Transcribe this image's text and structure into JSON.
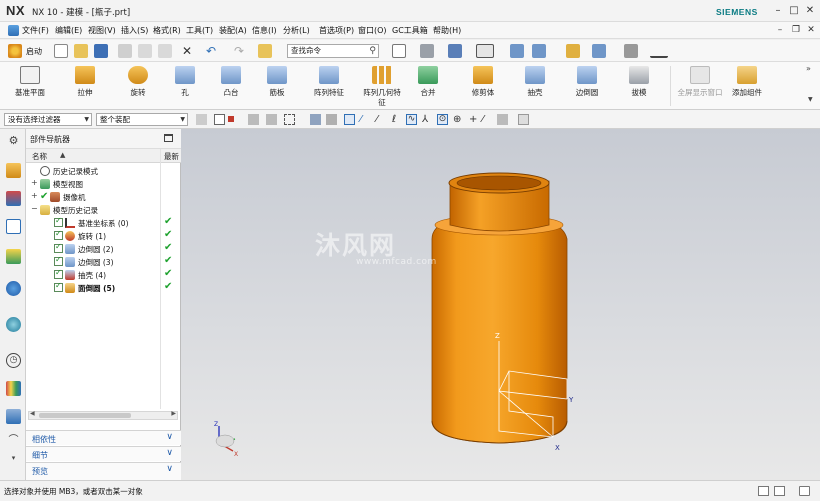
{
  "titlebar": {
    "logo": "NX",
    "title": "NX 10 - 建模 - [瓶子.prt]",
    "brand": "SIEMENS",
    "buttons": [
      "minimize",
      "maximize",
      "close"
    ]
  },
  "menubar": {
    "items": [
      "文件(F)",
      "编辑(E)",
      "视图(V)",
      "插入(S)",
      "格式(R)",
      "工具(T)",
      "装配(A)",
      "信息(I)",
      "分析(L)",
      "首选项(P)",
      "窗口(O)",
      "GC工具箱",
      "帮助(H)"
    ]
  },
  "qat": {
    "start_label": "启动",
    "find_placeholder": "查找命令"
  },
  "ribbon": {
    "buttons": [
      "基准平面",
      "拉伸",
      "旋转",
      "孔",
      "凸台",
      "筋板",
      "阵列特征",
      "阵列几何特征",
      "合并",
      "修剪体",
      "抽壳",
      "边倒圆",
      "拔模",
      "全屏显示窗口",
      "添加组件"
    ]
  },
  "selection_bar": {
    "filter": "没有选择过滤器",
    "scope": "整个装配"
  },
  "navigator": {
    "title": "部件导航器",
    "col_name": "名称",
    "col_latest": "最新",
    "items": [
      {
        "label": "历史记录模式",
        "level": 0,
        "expander": "",
        "latest": false
      },
      {
        "label": "模型视图",
        "level": 0,
        "expander": "+",
        "latest": false
      },
      {
        "label": "摄像机",
        "level": 0,
        "expander": "+",
        "latest": false
      },
      {
        "label": "模型历史记录",
        "level": 0,
        "expander": "−",
        "latest": false
      },
      {
        "label": "基准坐标系 (0)",
        "level": 1,
        "expander": "",
        "latest": true
      },
      {
        "label": "旋转 (1)",
        "level": 1,
        "expander": "",
        "latest": true
      },
      {
        "label": "边倒圆 (2)",
        "level": 1,
        "expander": "",
        "latest": true
      },
      {
        "label": "边倒圆 (3)",
        "level": 1,
        "expander": "",
        "latest": true
      },
      {
        "label": "抽壳 (4)",
        "level": 1,
        "expander": "",
        "latest": true
      },
      {
        "label": "面倒圆 (5)",
        "level": 1,
        "expander": "",
        "latest": true
      }
    ],
    "panels": [
      "相依性",
      "细节",
      "预览"
    ]
  },
  "viewport": {
    "watermark": "沐风网",
    "watermark_url": "www.mfcad.com",
    "axes": {
      "x": "X",
      "y": "Y",
      "z": "Z"
    }
  },
  "status": {
    "text": "选择对象并使用 MB3，或者双击某一对象"
  },
  "colors": {
    "part_orange": "#f08a0a",
    "brand_teal": "#0a7b83",
    "check_green": "#1fa22f"
  }
}
